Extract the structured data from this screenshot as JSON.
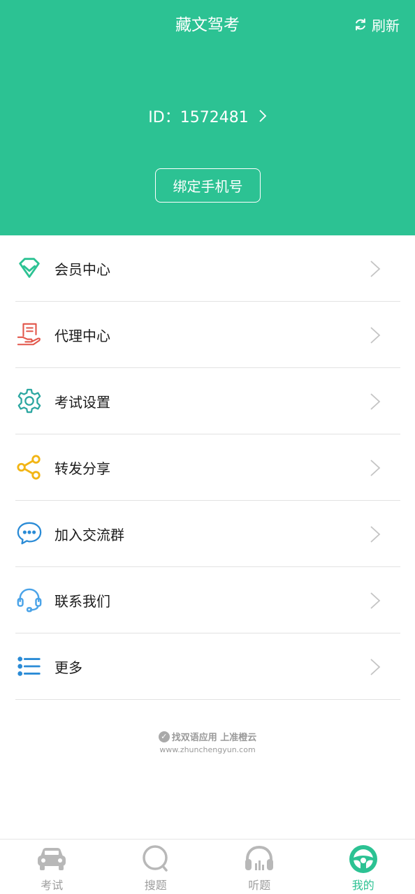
{
  "header": {
    "title": "藏文驾考",
    "refresh_label": "刷新",
    "user_id": "ID：1572481",
    "bind_phone_label": "绑定手机号"
  },
  "menu": {
    "items": [
      {
        "label": "会员中心",
        "icon": "diamond-icon",
        "color": "#2cc293"
      },
      {
        "label": "代理中心",
        "icon": "agent-hand-icon",
        "color": "#e2564a"
      },
      {
        "label": "考试设置",
        "icon": "gear-icon",
        "color": "#2aa6a0"
      },
      {
        "label": "转发分享",
        "icon": "share-icon",
        "color": "#f2b515"
      },
      {
        "label": "加入交流群",
        "icon": "chat-bubble-icon",
        "color": "#2a8bd6"
      },
      {
        "label": "联系我们",
        "icon": "headset-icon",
        "color": "#4aa3e8"
      },
      {
        "label": "更多",
        "icon": "list-icon",
        "color": "#2a8bd6"
      }
    ]
  },
  "watermark": {
    "line1": "找双语应用 上准橙云",
    "line2": "www.zhunchengyun.com"
  },
  "tabbar": {
    "tabs": [
      {
        "label": "考试",
        "icon": "car-icon",
        "active": false
      },
      {
        "label": "搜题",
        "icon": "search-icon",
        "active": false
      },
      {
        "label": "听题",
        "icon": "listen-icon",
        "active": false
      },
      {
        "label": "我的",
        "icon": "steering-wheel-icon",
        "active": true
      }
    ]
  },
  "colors": {
    "brand": "#2cc293",
    "inactive_tab": "#b8b8b8",
    "divider": "#e2e2e2"
  }
}
